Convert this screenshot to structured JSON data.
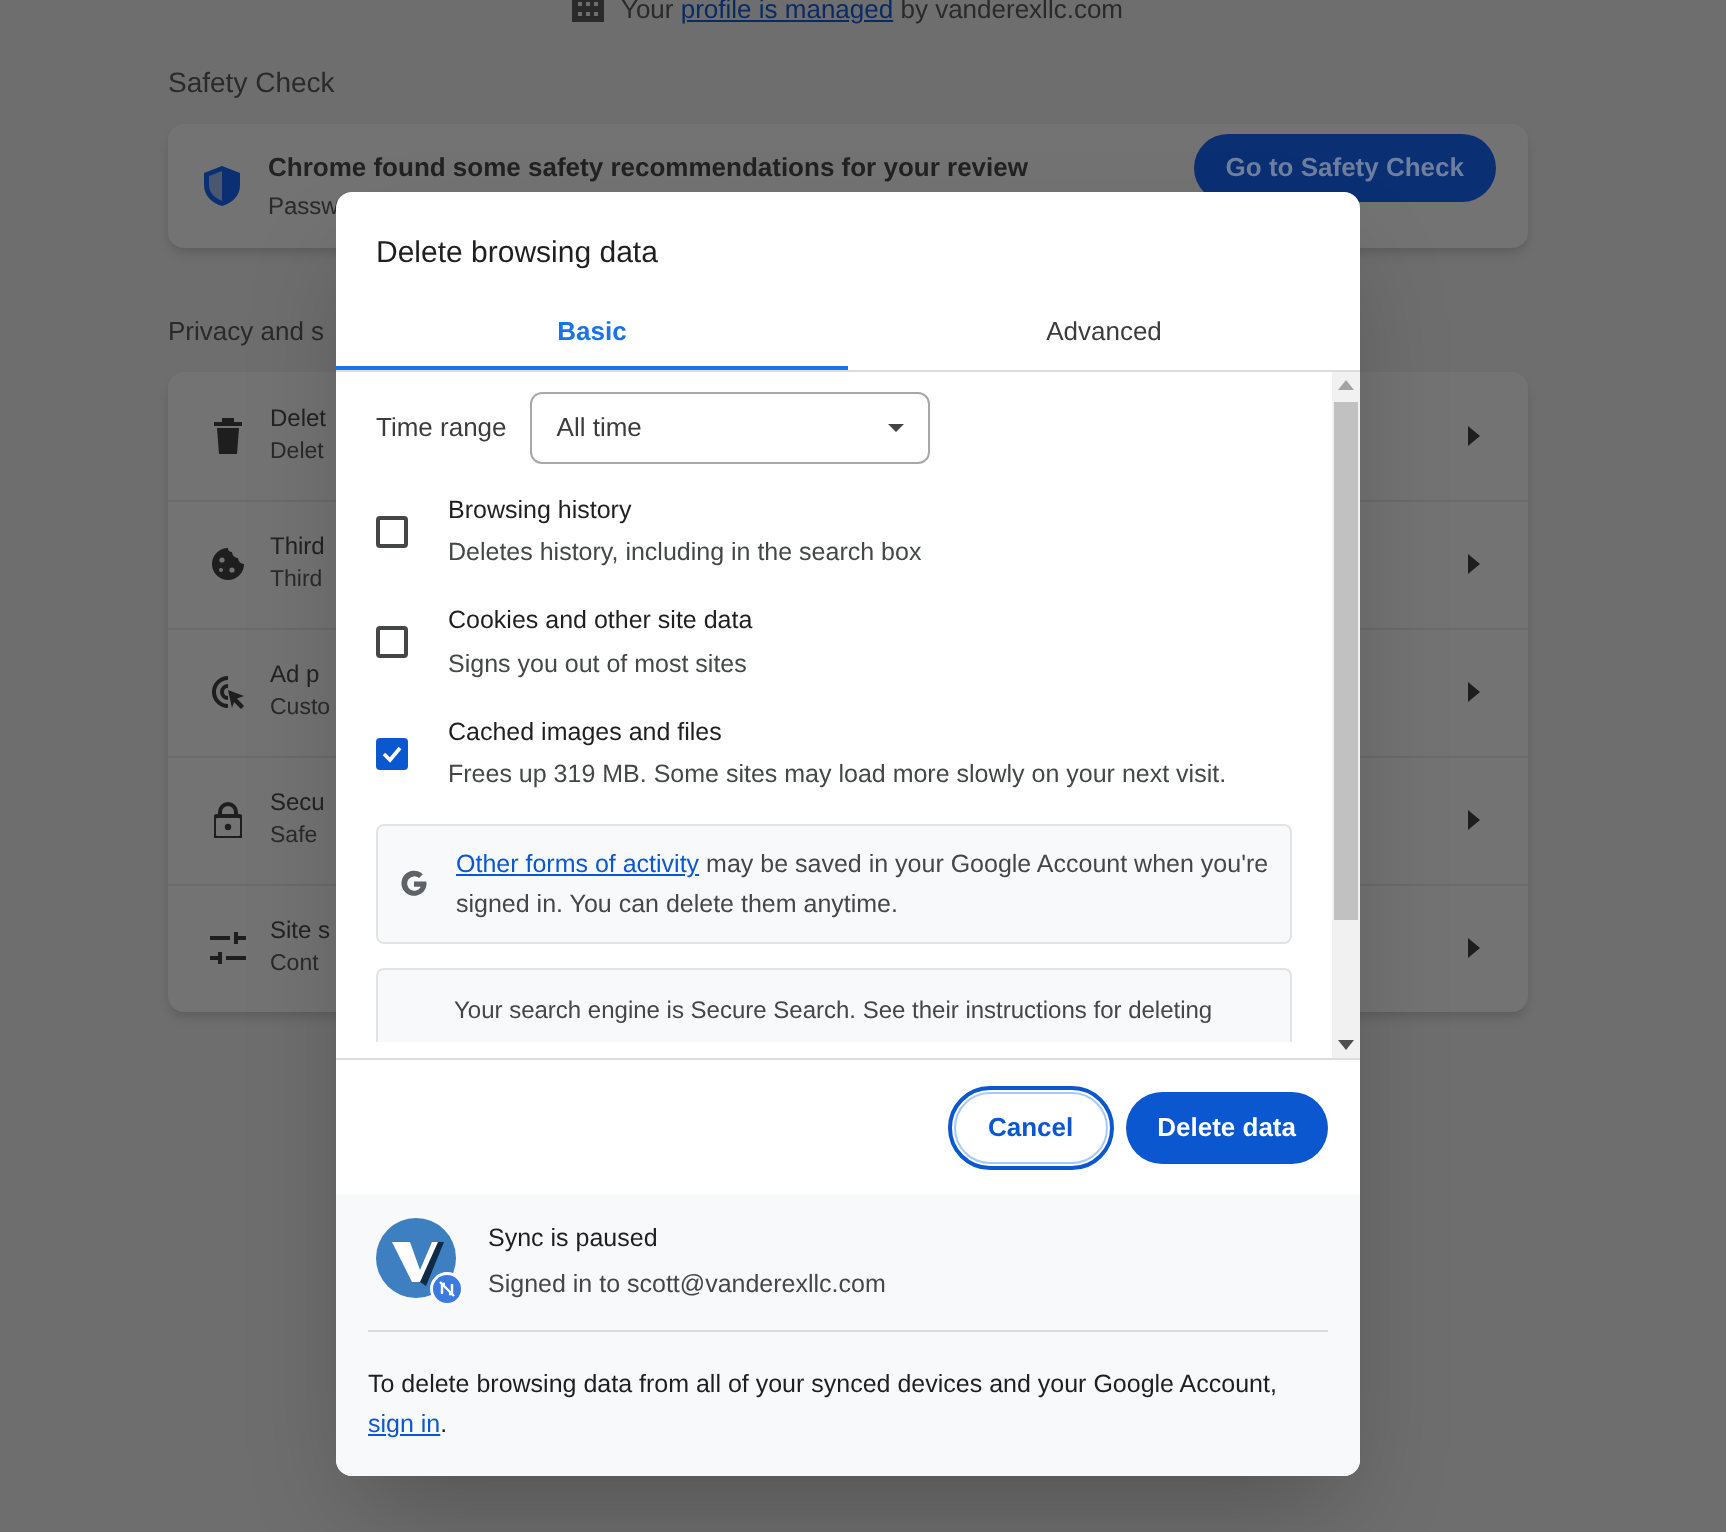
{
  "page": {
    "managed_notice": {
      "prefix": "Your",
      "link": "profile is managed",
      "suffix": "by vanderexllc.com"
    },
    "safety_check": {
      "heading": "Safety Check",
      "title": "Chrome found some safety recommendations for your review",
      "subtitle": "Passw",
      "button": "Go to Safety Check"
    },
    "privacy": {
      "heading": "Privacy and s",
      "rows": [
        {
          "kind": "trash",
          "title": "Delet",
          "subtitle": "Delet"
        },
        {
          "kind": "cookie",
          "title": "Third",
          "subtitle": "Third"
        },
        {
          "kind": "ad",
          "title": "Ad p",
          "subtitle": "Custo"
        },
        {
          "kind": "lock",
          "title": "Secu",
          "subtitle": "Safe"
        },
        {
          "kind": "sliders",
          "title": "Site s",
          "subtitle": "Cont"
        }
      ]
    }
  },
  "dialog": {
    "title": "Delete browsing data",
    "tabs": [
      {
        "label": "Basic",
        "selected": true
      },
      {
        "label": "Advanced",
        "selected": false
      }
    ],
    "time_range": {
      "label": "Time range",
      "value": "All time"
    },
    "options": [
      {
        "title": "Browsing history",
        "description": "Deletes history, including in the search box",
        "checked": false
      },
      {
        "title": "Cookies and other site data",
        "description": "Signs you out of most sites",
        "checked": false
      },
      {
        "title": "Cached images and files",
        "description": "Frees up 319 MB. Some sites may load more slowly on your next visit.",
        "checked": true
      }
    ],
    "activity_notice": {
      "link": "Other forms of activity",
      "text": "may be saved in your Google Account when you're signed in. You can delete them anytime."
    },
    "search_notice": {
      "text": "Your search engine is Secure Search. See their instructions for deleting"
    },
    "buttons": {
      "cancel": "Cancel",
      "confirm": "Delete data"
    },
    "sync": {
      "status": "Sync is paused",
      "account": "Signed in to scott@vanderexllc.com"
    },
    "footer": {
      "text": "To delete browsing data from all of your synced devices and your Google Account,",
      "link": "sign in",
      "suffix": "."
    }
  }
}
